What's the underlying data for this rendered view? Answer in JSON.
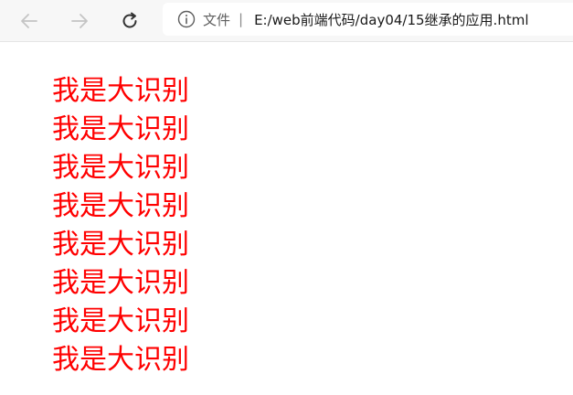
{
  "browser": {
    "address_bar": {
      "site_label": "文件",
      "separator": "|",
      "url": "E:/web前端代码/day04/15继承的应用.html"
    },
    "icons": {
      "back": "back-arrow-icon",
      "forward": "forward-arrow-icon",
      "reload": "reload-icon",
      "site_info": "info-icon"
    }
  },
  "page": {
    "lines": [
      "我是大识别",
      "我是大识别",
      "我是大识别",
      "我是大识别",
      "我是大识别",
      "我是大识别",
      "我是大识别",
      "我是大识别"
    ],
    "text_color": "#ff0000"
  }
}
